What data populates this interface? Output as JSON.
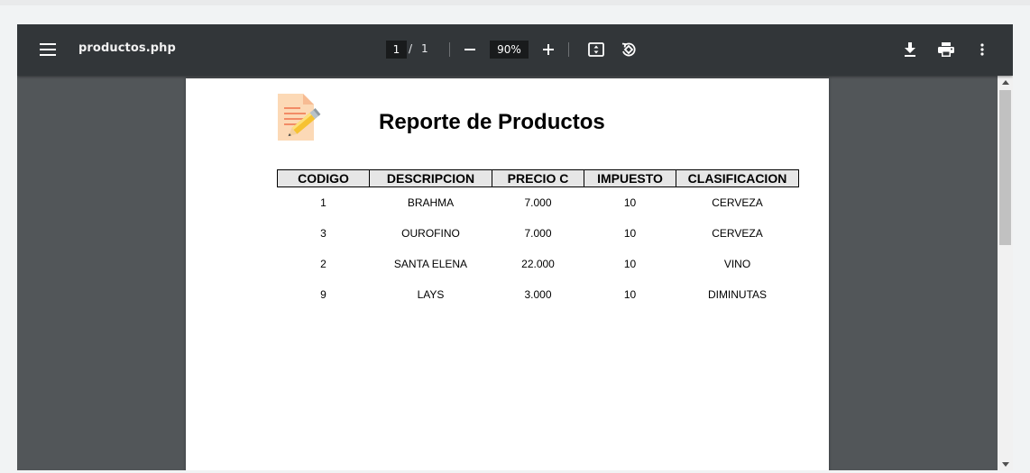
{
  "viewer": {
    "filename": "productos.php",
    "current_page": "1",
    "page_separator": "/",
    "total_pages": "1",
    "zoom": "90%"
  },
  "icons": {
    "menu": "hamburger-menu-icon",
    "zoom_out": "minus-icon",
    "zoom_in": "plus-icon",
    "fit": "fit-to-page-icon",
    "rotate": "rotate-counterclockwise-icon",
    "download": "download-icon",
    "print": "printer-icon",
    "more": "more-vertical-icon",
    "logo": "notepad-pencil-icon"
  },
  "report": {
    "title": "Reporte de Productos",
    "columns": [
      "CODIGO",
      "DESCRIPCION",
      "PRECIO C",
      "IMPUESTO",
      "CLASIFICACION"
    ],
    "rows": [
      [
        "1",
        "BRAHMA",
        "7.000",
        "10",
        "CERVEZA"
      ],
      [
        "3",
        "OUROFINO",
        "7.000",
        "10",
        "CERVEZA"
      ],
      [
        "2",
        "SANTA ELENA",
        "22.000",
        "10",
        "VINO"
      ],
      [
        "9",
        "LAYS",
        "3.000",
        "10",
        "DIMINUTAS"
      ]
    ]
  },
  "colors": {
    "toolbar": "#323639",
    "viewer_background": "#525659",
    "header_cell": "#e6e6e6"
  }
}
